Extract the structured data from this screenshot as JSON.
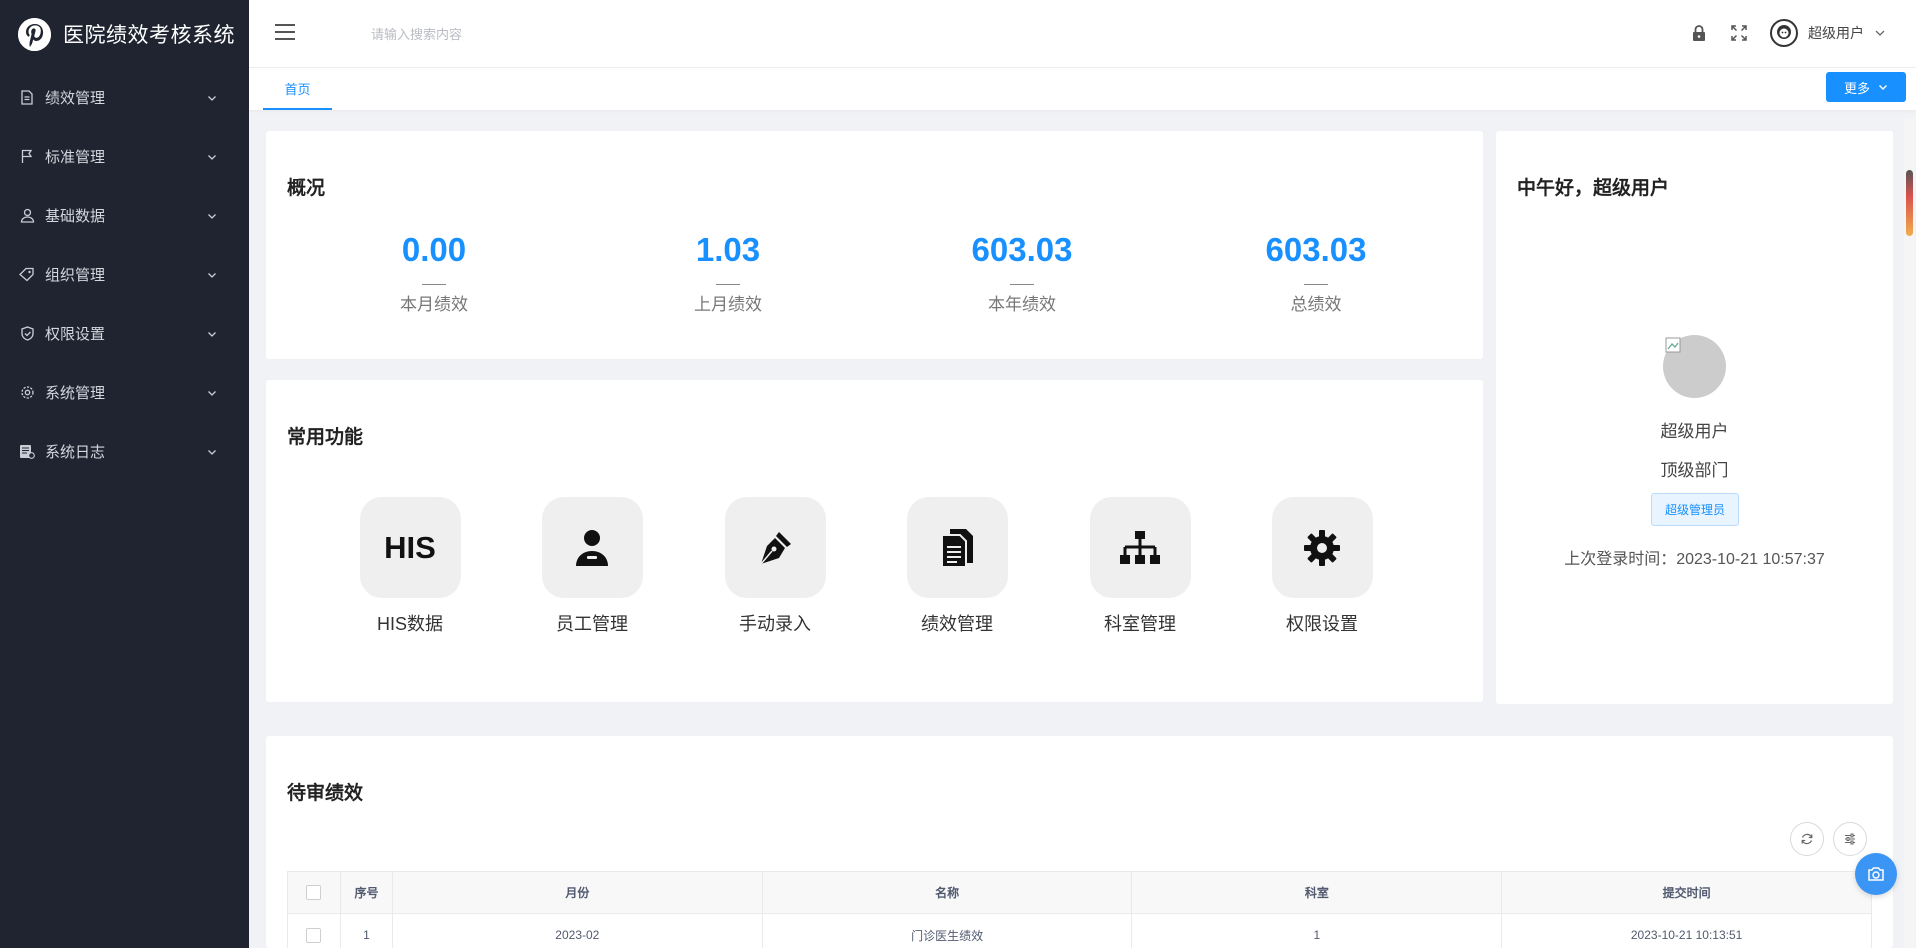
{
  "app": {
    "title": "医院绩效考核系统",
    "logo_icon": "pinterest-logo-icon"
  },
  "sidebar": {
    "items": [
      {
        "label": "绩效管理",
        "icon": "document-icon"
      },
      {
        "label": "标准管理",
        "icon": "flag-icon"
      },
      {
        "label": "基础数据",
        "icon": "user-icon"
      },
      {
        "label": "组织管理",
        "icon": "tag-icon"
      },
      {
        "label": "权限设置",
        "icon": "shield-check-icon"
      },
      {
        "label": "系统管理",
        "icon": "gear-icon"
      },
      {
        "label": "系统日志",
        "icon": "log-icon"
      }
    ]
  },
  "header": {
    "search_placeholder": "请输入搜索内容",
    "user_name": "超级用户"
  },
  "tabs": {
    "home": "首页",
    "more_button": "更多"
  },
  "overview": {
    "title": "概况",
    "stats": [
      {
        "value": "0.00",
        "label": "本月绩效"
      },
      {
        "value": "1.03",
        "label": "上月绩效"
      },
      {
        "value": "603.03",
        "label": "本年绩效"
      },
      {
        "value": "603.03",
        "label": "总绩效"
      }
    ]
  },
  "functions": {
    "title": "常用功能",
    "items": [
      {
        "label": "HIS数据",
        "icon": "his-icon",
        "icon_text": "HIS"
      },
      {
        "label": "员工管理",
        "icon": "employee-icon"
      },
      {
        "label": "手动录入",
        "icon": "pen-nib-icon"
      },
      {
        "label": "绩效管理",
        "icon": "documents-icon"
      },
      {
        "label": "科室管理",
        "icon": "org-chart-icon"
      },
      {
        "label": "权限设置",
        "icon": "gear-icon"
      }
    ]
  },
  "profile": {
    "greeting": "中午好，超级用户",
    "name": "超级用户",
    "department": "顶级部门",
    "role": "超级管理员",
    "last_login": "上次登录时间：2023-10-21 10:57:37"
  },
  "pending": {
    "title": "待审绩效",
    "columns": [
      "序号",
      "月份",
      "名称",
      "科室",
      "提交时间"
    ],
    "rows": [
      [
        "1",
        "2023-02",
        "门诊医生绩效",
        "1",
        "2023-10-21 10:13:51"
      ]
    ]
  },
  "colors": {
    "accent": "#1890ff",
    "sidebar_bg": "#1f2430"
  }
}
